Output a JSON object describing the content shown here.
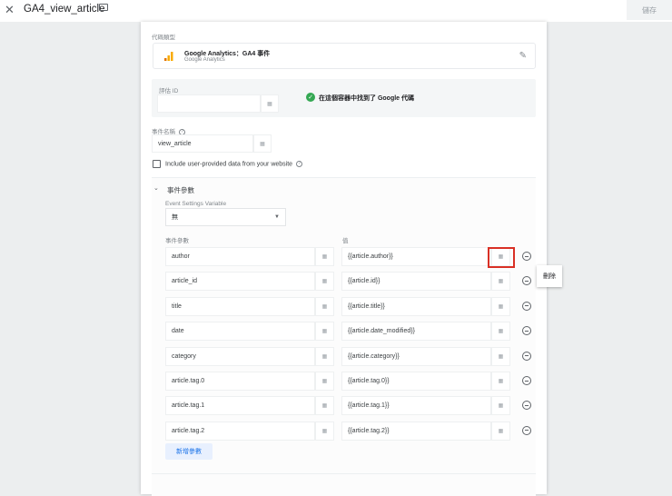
{
  "header": {
    "title": "GA4_view_article",
    "save_label": "儲存"
  },
  "tag_type": {
    "label": "代碼類型",
    "name": "Google Analytics：GA4 事件",
    "sub": "Google Analytics"
  },
  "measurement": {
    "label": "評估 ID",
    "value": "",
    "status": "在這個容器中找到了 Google 代碼"
  },
  "event_name": {
    "label": "事件名稱",
    "value": "view_article"
  },
  "include_user_data": {
    "label": "Include user-provided data from your website",
    "checked": false
  },
  "event_params": {
    "section_title": "事件參數",
    "settings_var_label": "Event Settings Variable",
    "settings_var_value": "無",
    "col_param": "事件參數",
    "col_value": "值",
    "rows": [
      {
        "name": "author",
        "value": "{{article.author}}"
      },
      {
        "name": "article_id",
        "value": "{{article.id}}"
      },
      {
        "name": "title",
        "value": "{{article.title}}"
      },
      {
        "name": "date",
        "value": "{{article.date_modified}}"
      },
      {
        "name": "category",
        "value": "{{article.category}}"
      },
      {
        "name": "article.tag.0",
        "value": "{{article.tag.0}}"
      },
      {
        "name": "article.tag.1",
        "value": "{{article.tag.1}}"
      },
      {
        "name": "article.tag.2",
        "value": "{{article.tag.2}}"
      }
    ],
    "add_label": "新增參數"
  },
  "tooltip": "刪除",
  "colors": {
    "highlight": "#d93025",
    "accent": "#1a73e8",
    "success": "#34a853"
  }
}
